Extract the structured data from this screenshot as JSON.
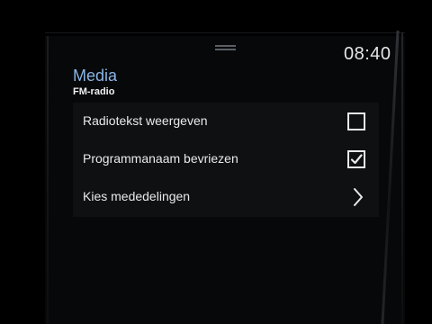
{
  "status": {
    "clock": "08:40"
  },
  "header": {
    "title": "Media",
    "subtitle": "FM-radio"
  },
  "settings": {
    "items": [
      {
        "label": "Radiotekst weergeven",
        "control": "checkbox",
        "checked": false
      },
      {
        "label": "Programmanaam bevriezen",
        "control": "checkbox",
        "checked": true
      },
      {
        "label": "Kies mededelingen",
        "control": "chevron-right-icon"
      }
    ]
  },
  "colors": {
    "background": "#000000",
    "panel": "#0e1012",
    "accent_title": "#8ab4e6",
    "text": "#e8eaec"
  }
}
